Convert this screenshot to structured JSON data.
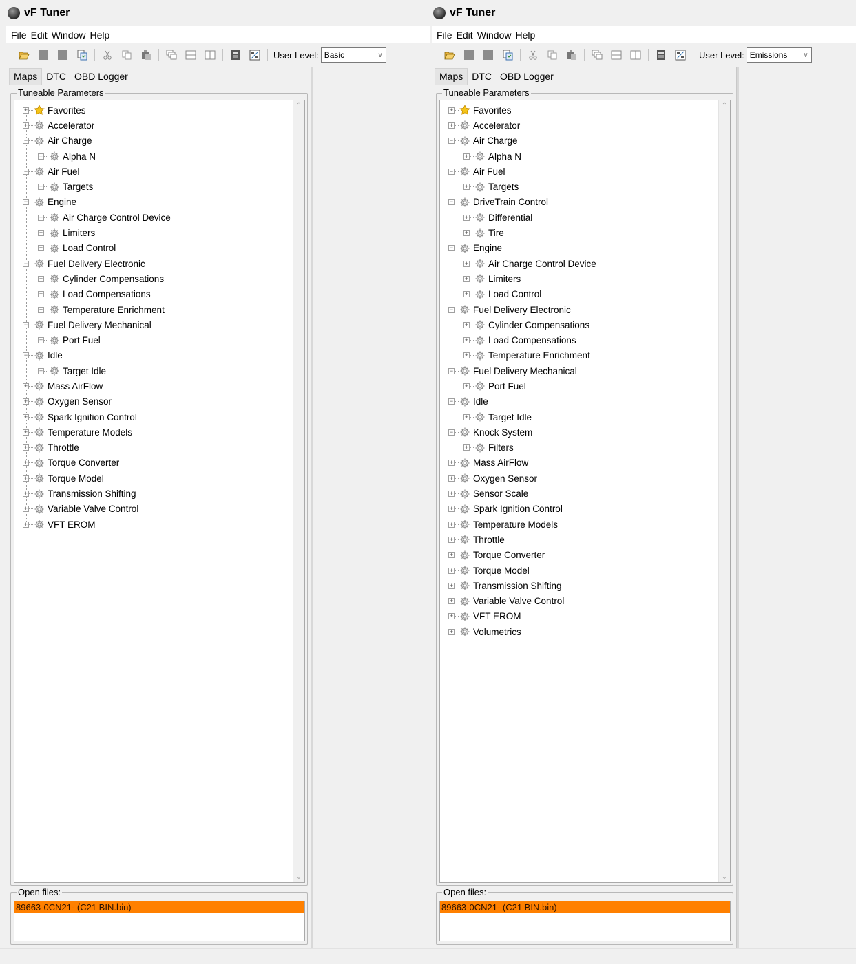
{
  "windows": [
    {
      "title": "vF Tuner",
      "menu": [
        "File",
        "Edit",
        "Window",
        "Help"
      ],
      "user_level_label": "User Level:",
      "user_level_value": "Basic",
      "tabs": [
        "Maps",
        "DTC",
        "OBD Logger"
      ],
      "active_tab": "Maps",
      "tree_title": "Tuneable Parameters",
      "files_title": "Open files:",
      "open_files": [
        "89663-0CN21- (C21 BIN.bin)"
      ],
      "tree": [
        {
          "label": "Favorites",
          "icon": "star",
          "level": 0
        },
        {
          "label": "Accelerator",
          "icon": "gear",
          "level": 0
        },
        {
          "label": "Air Charge",
          "icon": "gear",
          "level": 0,
          "expanded": true,
          "children": [
            {
              "label": "Alpha N",
              "icon": "gear",
              "level": 1
            }
          ]
        },
        {
          "label": "Air Fuel",
          "icon": "gear",
          "level": 0,
          "expanded": true,
          "children": [
            {
              "label": "Targets",
              "icon": "gear",
              "level": 1
            }
          ]
        },
        {
          "label": "Engine",
          "icon": "gear",
          "level": 0,
          "expanded": true,
          "children": [
            {
              "label": "Air Charge Control Device",
              "icon": "gear",
              "level": 1
            },
            {
              "label": "Limiters",
              "icon": "gear",
              "level": 1
            },
            {
              "label": "Load Control",
              "icon": "gear",
              "level": 1
            }
          ]
        },
        {
          "label": "Fuel Delivery Electronic",
          "icon": "gear",
          "level": 0,
          "expanded": true,
          "children": [
            {
              "label": "Cylinder Compensations",
              "icon": "gear",
              "level": 1
            },
            {
              "label": "Load Compensations",
              "icon": "gear",
              "level": 1
            },
            {
              "label": "Temperature Enrichment",
              "icon": "gear",
              "level": 1
            }
          ]
        },
        {
          "label": "Fuel Delivery Mechanical",
          "icon": "gear",
          "level": 0,
          "expanded": true,
          "children": [
            {
              "label": "Port Fuel",
              "icon": "gear",
              "level": 1
            }
          ]
        },
        {
          "label": "Idle",
          "icon": "gear",
          "level": 0,
          "expanded": true,
          "children": [
            {
              "label": "Target Idle",
              "icon": "gear",
              "level": 1
            }
          ]
        },
        {
          "label": "Mass AirFlow",
          "icon": "gear",
          "level": 0
        },
        {
          "label": "Oxygen Sensor",
          "icon": "gear",
          "level": 0
        },
        {
          "label": "Spark Ignition Control",
          "icon": "gear",
          "level": 0
        },
        {
          "label": "Temperature Models",
          "icon": "gear",
          "level": 0
        },
        {
          "label": "Throttle",
          "icon": "gear",
          "level": 0
        },
        {
          "label": "Torque Converter",
          "icon": "gear",
          "level": 0
        },
        {
          "label": "Torque Model",
          "icon": "gear",
          "level": 0
        },
        {
          "label": "Transmission Shifting",
          "icon": "gear",
          "level": 0
        },
        {
          "label": "Variable Valve Control",
          "icon": "gear",
          "level": 0
        },
        {
          "label": "VFT EROM",
          "icon": "gear",
          "level": 0
        }
      ]
    },
    {
      "title": "vF Tuner",
      "menu": [
        "File",
        "Edit",
        "Window",
        "Help"
      ],
      "user_level_label": "User Level:",
      "user_level_value": "Emissions",
      "tabs": [
        "Maps",
        "DTC",
        "OBD Logger"
      ],
      "active_tab": "Maps",
      "tree_title": "Tuneable Parameters",
      "files_title": "Open files:",
      "open_files": [
        "89663-0CN21- (C21 BIN.bin)"
      ],
      "tree": [
        {
          "label": "Favorites",
          "icon": "star",
          "level": 0
        },
        {
          "label": "Accelerator",
          "icon": "gear",
          "level": 0
        },
        {
          "label": "Air Charge",
          "icon": "gear",
          "level": 0,
          "expanded": true,
          "children": [
            {
              "label": "Alpha N",
              "icon": "gear",
              "level": 1
            }
          ]
        },
        {
          "label": "Air Fuel",
          "icon": "gear",
          "level": 0,
          "expanded": true,
          "children": [
            {
              "label": "Targets",
              "icon": "gear",
              "level": 1
            }
          ]
        },
        {
          "label": "DriveTrain Control",
          "icon": "gear",
          "level": 0,
          "expanded": true,
          "children": [
            {
              "label": "Differential",
              "icon": "gear",
              "level": 1
            },
            {
              "label": "Tire",
              "icon": "gear",
              "level": 1
            }
          ]
        },
        {
          "label": "Engine",
          "icon": "gear",
          "level": 0,
          "expanded": true,
          "children": [
            {
              "label": "Air Charge Control Device",
              "icon": "gear",
              "level": 1
            },
            {
              "label": "Limiters",
              "icon": "gear",
              "level": 1
            },
            {
              "label": "Load Control",
              "icon": "gear",
              "level": 1
            }
          ]
        },
        {
          "label": "Fuel Delivery Electronic",
          "icon": "gear",
          "level": 0,
          "expanded": true,
          "children": [
            {
              "label": "Cylinder Compensations",
              "icon": "gear",
              "level": 1
            },
            {
              "label": "Load Compensations",
              "icon": "gear",
              "level": 1
            },
            {
              "label": "Temperature Enrichment",
              "icon": "gear",
              "level": 1
            }
          ]
        },
        {
          "label": "Fuel Delivery Mechanical",
          "icon": "gear",
          "level": 0,
          "expanded": true,
          "children": [
            {
              "label": "Port Fuel",
              "icon": "gear",
              "level": 1
            }
          ]
        },
        {
          "label": "Idle",
          "icon": "gear",
          "level": 0,
          "expanded": true,
          "children": [
            {
              "label": "Target Idle",
              "icon": "gear",
              "level": 1
            }
          ]
        },
        {
          "label": "Knock System",
          "icon": "gear",
          "level": 0,
          "expanded": true,
          "children": [
            {
              "label": "Filters",
              "icon": "gear",
              "level": 1
            }
          ]
        },
        {
          "label": "Mass AirFlow",
          "icon": "gear",
          "level": 0
        },
        {
          "label": "Oxygen Sensor",
          "icon": "gear",
          "level": 0
        },
        {
          "label": "Sensor Scale",
          "icon": "gear",
          "level": 0
        },
        {
          "label": "Spark Ignition Control",
          "icon": "gear",
          "level": 0
        },
        {
          "label": "Temperature Models",
          "icon": "gear",
          "level": 0
        },
        {
          "label": "Throttle",
          "icon": "gear",
          "level": 0
        },
        {
          "label": "Torque Converter",
          "icon": "gear",
          "level": 0
        },
        {
          "label": "Torque Model",
          "icon": "gear",
          "level": 0
        },
        {
          "label": "Transmission Shifting",
          "icon": "gear",
          "level": 0
        },
        {
          "label": "Variable Valve Control",
          "icon": "gear",
          "level": 0
        },
        {
          "label": "VFT EROM",
          "icon": "gear",
          "level": 0
        },
        {
          "label": "Volumetrics",
          "icon": "gear",
          "level": 0
        }
      ]
    }
  ],
  "toolbar_icons": [
    "open-folder-icon",
    "save-icon",
    "save-all-icon",
    "copy-file-icon",
    "cut-icon",
    "copy-icon",
    "paste-icon",
    "cascade-icon",
    "tile-horizontal-icon",
    "tile-vertical-icon",
    "calculator-icon",
    "compare-icon"
  ],
  "colors": {
    "selected_file_bg": "#ff8000",
    "window_bg": "#f0f0f0",
    "tree_bg": "#ffffff"
  }
}
